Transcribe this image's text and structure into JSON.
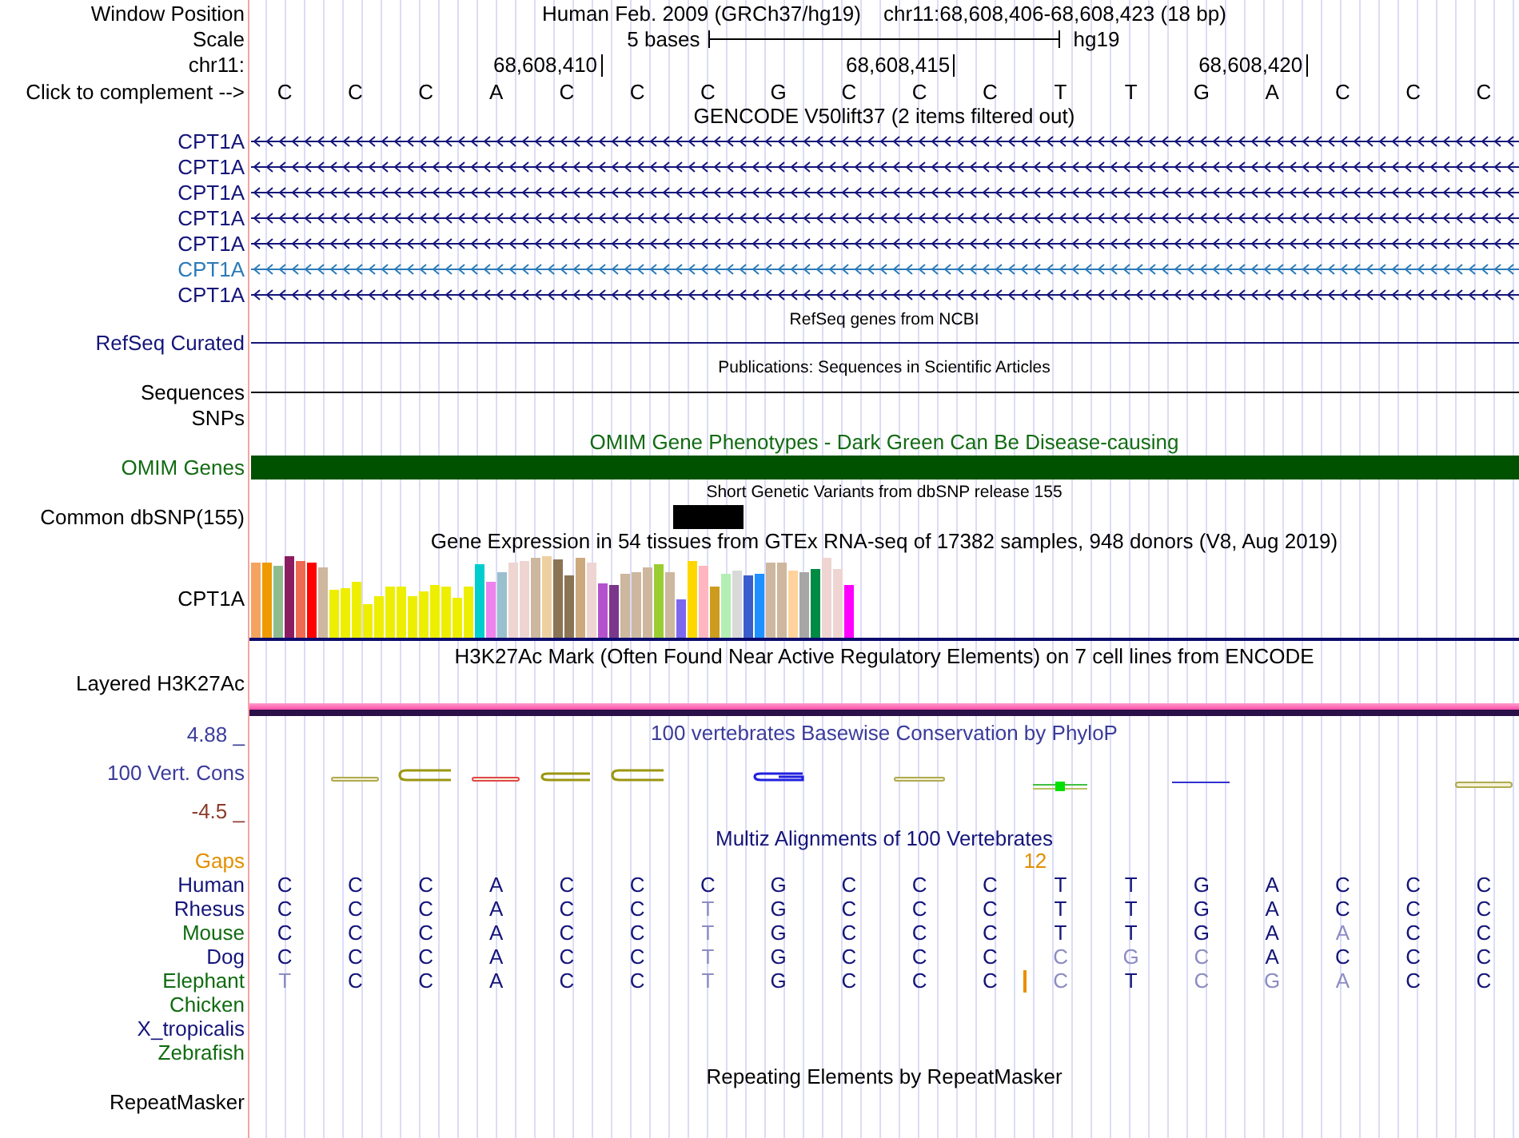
{
  "position": {
    "label": "Window Position",
    "assembly": "Human Feb. 2009 (GRCh37/hg19)",
    "range": "chr11:68,608,406-68,608,423 (18 bp)"
  },
  "scale": {
    "label": "Scale",
    "length": "5 bases",
    "assembly": "hg19"
  },
  "ruler": {
    "label": "chr11:",
    "positions": [
      "68,608,410",
      "68,608,415",
      "68,608,420"
    ]
  },
  "sequence": {
    "label": "Click to complement -->",
    "bases": [
      "C",
      "C",
      "C",
      "A",
      "C",
      "C",
      "C",
      "G",
      "C",
      "C",
      "C",
      "T",
      "T",
      "G",
      "A",
      "C",
      "C",
      "C"
    ]
  },
  "tracks": [
    {
      "kind": "genes",
      "title": "GENCODE V50lift37 (2 items filtered out)",
      "items": [
        {
          "name": "CPT1A",
          "color": "#14147a"
        },
        {
          "name": "CPT1A",
          "color": "#14147a"
        },
        {
          "name": "CPT1A",
          "color": "#14147a"
        },
        {
          "name": "CPT1A",
          "color": "#14147a"
        },
        {
          "name": "CPT1A",
          "color": "#14147a"
        },
        {
          "name": "CPT1A",
          "color": "#2a7ab8"
        },
        {
          "name": "CPT1A",
          "color": "#14147a"
        }
      ]
    },
    {
      "kind": "line",
      "title": "RefSeq genes from NCBI",
      "label": "RefSeq Curated",
      "color": "#14147a"
    },
    {
      "kind": "line",
      "title": "Publications: Sequences in Scientific Articles",
      "label": "Sequences",
      "color": "#000000"
    },
    {
      "kind": "blank",
      "label": "SNPs"
    },
    {
      "kind": "bar",
      "title": "OMIM Gene Phenotypes - Dark Green Can Be Disease-causing",
      "label": "OMIM Genes"
    },
    {
      "kind": "snp",
      "title": "Short Genetic Variants from dbSNP release 155",
      "label": "Common dbSNP(155)",
      "cells": [
        {
          "kind": "blank"
        },
        {
          "kind": "blank"
        },
        {
          "kind": "blank"
        },
        {
          "kind": "blank"
        },
        {
          "kind": "blank"
        },
        {
          "kind": "blank"
        },
        {
          "kind": "variant"
        },
        {
          "kind": "blank"
        },
        {
          "kind": "blank"
        },
        {
          "kind": "blank"
        },
        {
          "kind": "blank"
        },
        {
          "kind": "blank"
        },
        {
          "kind": "blank"
        },
        {
          "kind": "blank"
        },
        {
          "kind": "blank"
        },
        {
          "kind": "blank"
        },
        {
          "kind": "blank"
        },
        {
          "kind": "blank"
        }
      ]
    },
    {
      "kind": "expression",
      "title": "Gene Expression in 54 tissues from GTEx RNA-seq of 17382 samples, 948 donors (V8, Aug 2019)",
      "label": "CPT1A"
    },
    {
      "kind": "layered",
      "title": "H3K27Ac Mark (Often Found Near Active Regulatory Elements) on 7 cell lines from ENCODE",
      "label": "Layered H3K27Ac"
    },
    {
      "kind": "conservation",
      "title": "100 vertebrates Basewise Conservation by PhyloP",
      "label": "100 Vert. Cons",
      "max": "4.88 _",
      "min": "-4.5 _"
    },
    {
      "kind": "alignment",
      "title": "Multiz Alignments of 100 Vertebrates",
      "gaps_label": "Gaps",
      "gap_count": "12",
      "species": [
        {
          "name": "Human",
          "color": "#14147a",
          "cells": [
            {
              "kind": "base",
              "base": "C",
              "differs": false
            },
            {
              "kind": "base",
              "base": "C",
              "differs": false
            },
            {
              "kind": "base",
              "base": "C",
              "differs": false
            },
            {
              "kind": "base",
              "base": "A",
              "differs": false
            },
            {
              "kind": "base",
              "base": "C",
              "differs": false
            },
            {
              "kind": "base",
              "base": "C",
              "differs": false
            },
            {
              "kind": "base",
              "base": "C",
              "differs": false
            },
            {
              "kind": "base",
              "base": "G",
              "differs": false
            },
            {
              "kind": "base",
              "base": "C",
              "differs": false
            },
            {
              "kind": "base",
              "base": "C",
              "differs": false
            },
            {
              "kind": "base",
              "base": "C",
              "differs": false
            },
            {
              "kind": "base",
              "base": "T",
              "differs": false
            },
            {
              "kind": "base",
              "base": "T",
              "differs": false
            },
            {
              "kind": "base",
              "base": "G",
              "differs": false
            },
            {
              "kind": "base",
              "base": "A",
              "differs": false
            },
            {
              "kind": "base",
              "base": "C",
              "differs": false
            },
            {
              "kind": "base",
              "base": "C",
              "differs": false
            },
            {
              "kind": "base",
              "base": "C",
              "differs": false
            }
          ]
        },
        {
          "name": "Rhesus",
          "color": "#14147a",
          "cells": [
            {
              "kind": "base",
              "base": "C",
              "differs": false
            },
            {
              "kind": "base",
              "base": "C",
              "differs": false
            },
            {
              "kind": "base",
              "base": "C",
              "differs": false
            },
            {
              "kind": "base",
              "base": "A",
              "differs": false
            },
            {
              "kind": "base",
              "base": "C",
              "differs": false
            },
            {
              "kind": "base",
              "base": "C",
              "differs": false
            },
            {
              "kind": "base",
              "base": "T",
              "differs": true
            },
            {
              "kind": "base",
              "base": "G",
              "differs": false
            },
            {
              "kind": "base",
              "base": "C",
              "differs": false
            },
            {
              "kind": "base",
              "base": "C",
              "differs": false
            },
            {
              "kind": "base",
              "base": "C",
              "differs": false
            },
            {
              "kind": "base",
              "base": "T",
              "differs": false
            },
            {
              "kind": "base",
              "base": "T",
              "differs": false
            },
            {
              "kind": "base",
              "base": "G",
              "differs": false
            },
            {
              "kind": "base",
              "base": "A",
              "differs": false
            },
            {
              "kind": "base",
              "base": "C",
              "differs": false
            },
            {
              "kind": "base",
              "base": "C",
              "differs": false
            },
            {
              "kind": "base",
              "base": "C",
              "differs": false
            }
          ]
        },
        {
          "name": "Mouse",
          "color": "#0f6b0f",
          "cells": [
            {
              "kind": "base",
              "base": "C",
              "differs": false
            },
            {
              "kind": "base",
              "base": "C",
              "differs": false
            },
            {
              "kind": "base",
              "base": "C",
              "differs": false
            },
            {
              "kind": "base",
              "base": "A",
              "differs": false
            },
            {
              "kind": "base",
              "base": "C",
              "differs": false
            },
            {
              "kind": "base",
              "base": "C",
              "differs": false
            },
            {
              "kind": "base",
              "base": "T",
              "differs": true
            },
            {
              "kind": "base",
              "base": "G",
              "differs": false
            },
            {
              "kind": "base",
              "base": "C",
              "differs": false
            },
            {
              "kind": "base",
              "base": "C",
              "differs": false
            },
            {
              "kind": "base",
              "base": "C",
              "differs": false
            },
            {
              "kind": "base",
              "base": "T",
              "differs": false
            },
            {
              "kind": "base",
              "base": "T",
              "differs": false
            },
            {
              "kind": "base",
              "base": "G",
              "differs": false
            },
            {
              "kind": "base",
              "base": "A",
              "differs": false
            },
            {
              "kind": "base",
              "base": "A",
              "differs": true
            },
            {
              "kind": "base",
              "base": "C",
              "differs": false
            },
            {
              "kind": "base",
              "base": "C",
              "differs": false
            }
          ]
        },
        {
          "name": "Dog",
          "color": "#14147a",
          "cells": [
            {
              "kind": "base",
              "base": "C",
              "differs": false
            },
            {
              "kind": "base",
              "base": "C",
              "differs": false
            },
            {
              "kind": "base",
              "base": "C",
              "differs": false
            },
            {
              "kind": "base",
              "base": "A",
              "differs": false
            },
            {
              "kind": "base",
              "base": "C",
              "differs": false
            },
            {
              "kind": "base",
              "base": "C",
              "differs": false
            },
            {
              "kind": "base",
              "base": "T",
              "differs": true
            },
            {
              "kind": "base",
              "base": "G",
              "differs": false
            },
            {
              "kind": "base",
              "base": "C",
              "differs": false
            },
            {
              "kind": "base",
              "base": "C",
              "differs": false
            },
            {
              "kind": "base",
              "base": "C",
              "differs": false
            },
            {
              "kind": "base",
              "base": "C",
              "differs": true
            },
            {
              "kind": "base",
              "base": "G",
              "differs": true
            },
            {
              "kind": "base",
              "base": "C",
              "differs": true
            },
            {
              "kind": "base",
              "base": "A",
              "differs": false
            },
            {
              "kind": "base",
              "base": "C",
              "differs": false
            },
            {
              "kind": "base",
              "base": "C",
              "differs": false
            },
            {
              "kind": "base",
              "base": "C",
              "differs": false
            }
          ]
        },
        {
          "name": "Elephant",
          "color": "#0f6b0f",
          "cells": [
            {
              "kind": "base",
              "base": "T",
              "differs": true
            },
            {
              "kind": "base",
              "base": "C",
              "differs": false
            },
            {
              "kind": "base",
              "base": "C",
              "differs": false
            },
            {
              "kind": "base",
              "base": "A",
              "differs": false
            },
            {
              "kind": "base",
              "base": "C",
              "differs": false
            },
            {
              "kind": "base",
              "base": "C",
              "differs": false
            },
            {
              "kind": "base",
              "base": "T",
              "differs": true
            },
            {
              "kind": "base",
              "base": "G",
              "differs": false
            },
            {
              "kind": "base",
              "base": "C",
              "differs": false
            },
            {
              "kind": "base",
              "base": "C",
              "differs": false
            },
            {
              "kind": "base",
              "base": "C",
              "differs": false
            },
            {
              "kind": "insert"
            },
            {
              "kind": "base",
              "base": "C",
              "differs": true
            },
            {
              "kind": "base",
              "base": "T",
              "differs": false
            },
            {
              "kind": "base",
              "base": "C",
              "differs": true
            },
            {
              "kind": "base",
              "base": "G",
              "differs": true
            },
            {
              "kind": "base",
              "base": "A",
              "differs": true
            },
            {
              "kind": "base",
              "base": "C",
              "differs": false
            },
            {
              "kind": "base",
              "base": "C",
              "differs": false
            }
          ]
        },
        {
          "name": "Chicken",
          "color": "#0f6b0f"
        },
        {
          "name": "X_tropicalis",
          "color": "#14147a"
        },
        {
          "name": "Zebrafish",
          "color": "#0f6b0f"
        }
      ]
    },
    {
      "kind": "repeats",
      "title": "Repeating Elements by RepeatMasker",
      "label": "RepeatMasker"
    }
  ]
}
